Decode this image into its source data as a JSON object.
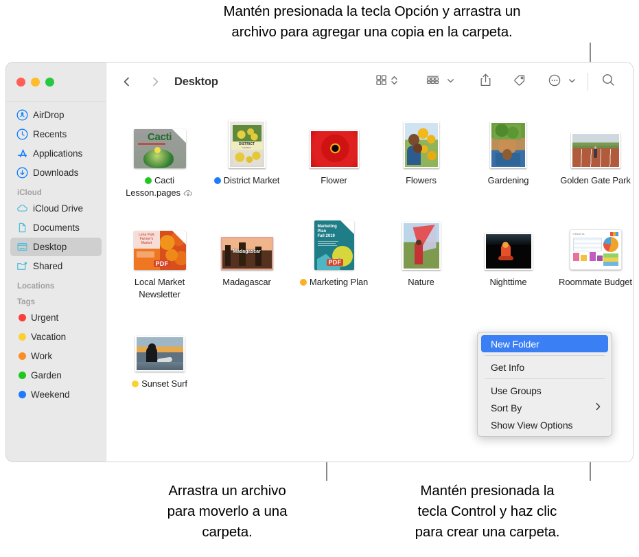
{
  "annotations": {
    "top": "Mantén presionada la tecla Opción y arrastra un\narchivo para agregar una copia en la carpeta.",
    "bottom_left": "Arrastra un archivo\npara moverlo a una\ncarpeta.",
    "bottom_right": "Mantén presionada la\ntecla Control y haz clic\npara crear una carpeta."
  },
  "window": {
    "traffic_lights": [
      "close",
      "minimize",
      "zoom"
    ]
  },
  "toolbar": {
    "back_icon": "chevron-left-icon",
    "forward_icon": "chevron-right-icon",
    "title": "Desktop",
    "view_icon": "grid-view-icon",
    "view_chevron_icon": "chevron-updown-icon",
    "group_icon": "group-by-icon",
    "group_chevron_icon": "chevron-down-icon",
    "share_icon": "share-icon",
    "tag_icon": "tag-icon",
    "more_icon": "ellipsis-circle-icon",
    "more_chevron_icon": "chevron-down-icon",
    "search_icon": "search-icon"
  },
  "sidebar": {
    "favorites": [
      {
        "label": "AirDrop",
        "icon": "airdrop-icon",
        "color": "#0a7cff"
      },
      {
        "label": "Recents",
        "icon": "clock-icon",
        "color": "#0a7cff"
      },
      {
        "label": "Applications",
        "icon": "appstore-icon",
        "color": "#0a7cff"
      },
      {
        "label": "Downloads",
        "icon": "download-icon",
        "color": "#0a7cff"
      }
    ],
    "icloud_header": "iCloud",
    "icloud": [
      {
        "label": "iCloud Drive",
        "icon": "cloud-icon",
        "color": "#4fbfd9",
        "selected": false
      },
      {
        "label": "Documents",
        "icon": "document-icon",
        "color": "#4fbfd9",
        "selected": false
      },
      {
        "label": "Desktop",
        "icon": "desktop-icon",
        "color": "#4fbfd9",
        "selected": true
      },
      {
        "label": "Shared",
        "icon": "shared-folder-icon",
        "color": "#4fbfd9",
        "selected": false
      }
    ],
    "locations_header": "Locations",
    "tags_header": "Tags",
    "tags": [
      {
        "label": "Urgent",
        "color": "#fc3d39"
      },
      {
        "label": "Vacation",
        "color": "#fcd02f"
      },
      {
        "label": "Work",
        "color": "#fa8e24"
      },
      {
        "label": "Garden",
        "color": "#1ec81e"
      },
      {
        "label": "Weekend",
        "color": "#1b7cff"
      }
    ]
  },
  "files": {
    "rows": [
      [
        {
          "name": "Cacti\nLesson.pages",
          "kind": "pages-document",
          "tag_color": "#1ec81e",
          "cloud": true
        },
        {
          "name": "District Market",
          "kind": "image",
          "tag_color": "#1b7cff",
          "cloud": false
        },
        {
          "name": "Flower",
          "kind": "image",
          "tag_color": null,
          "cloud": false
        },
        {
          "name": "Flowers",
          "kind": "image",
          "tag_color": null,
          "cloud": false
        },
        {
          "name": "Gardening",
          "kind": "image",
          "tag_color": null,
          "cloud": false
        },
        {
          "name": "Golden Gate Park",
          "kind": "image",
          "tag_color": null,
          "cloud": false
        }
      ],
      [
        {
          "name": "Local Market\nNewsletter",
          "kind": "pdf-document",
          "tag_color": null,
          "cloud": false
        },
        {
          "name": "Madagascar",
          "kind": "image",
          "tag_color": null,
          "cloud": false
        },
        {
          "name": "Marketing Plan",
          "kind": "pdf-document",
          "tag_color": "#fcb024",
          "cloud": false
        },
        {
          "name": "Nature",
          "kind": "image",
          "tag_color": null,
          "cloud": false
        },
        {
          "name": "Nighttime",
          "kind": "image",
          "tag_color": null,
          "cloud": false
        },
        {
          "name": "Roommate\nBudget",
          "kind": "numbers-document",
          "tag_color": null,
          "cloud": false
        }
      ],
      [
        {
          "name": "Sunset Surf",
          "kind": "image",
          "tag_color": "#fcd02f",
          "cloud": false
        }
      ]
    ]
  },
  "context_menu": {
    "items": [
      {
        "label": "New Folder",
        "highlighted": true,
        "submenu": false,
        "separator_after": true
      },
      {
        "label": "Get Info",
        "highlighted": false,
        "submenu": false,
        "separator_after": true
      },
      {
        "label": "Use Groups",
        "highlighted": false,
        "submenu": false,
        "separator_after": false
      },
      {
        "label": "Sort By",
        "highlighted": false,
        "submenu": true,
        "separator_after": false
      },
      {
        "label": "Show View Options",
        "highlighted": false,
        "submenu": false,
        "separator_after": false
      }
    ],
    "submenu_arrow": "chevron-right-icon"
  }
}
